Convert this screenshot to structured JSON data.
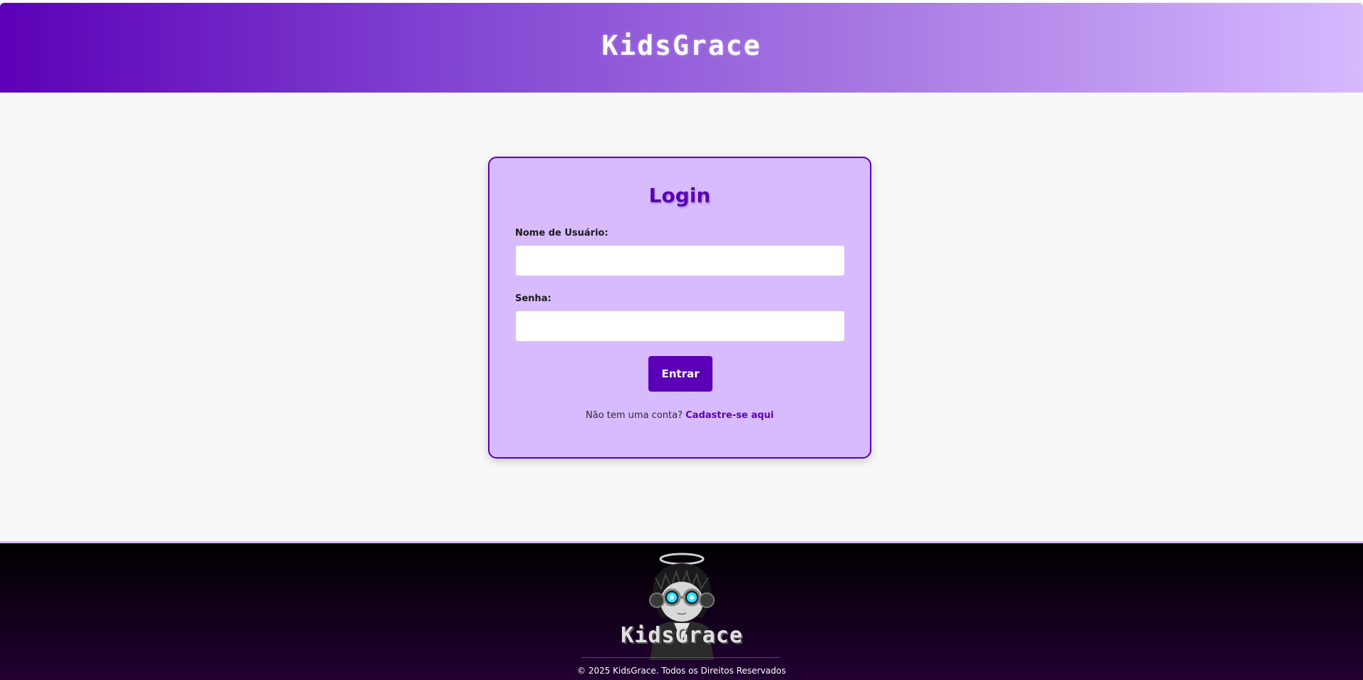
{
  "header": {
    "title": "KidsGrace"
  },
  "login": {
    "title": "Login",
    "username_label": "Nome de Usuário:",
    "username_value": "",
    "password_label": "Senha:",
    "password_value": "",
    "submit_label": "Entrar",
    "signup_prompt": "Não tem uma conta?",
    "signup_link": "Cadastre-se aqui"
  },
  "footer": {
    "logo_text": "KidsGrace",
    "copyright": "© 2025 KidsGrace. Todos os Direitos Reservados"
  },
  "colors": {
    "primary": "#5c00b7",
    "card_bg": "#d8bbff",
    "page_bg": "#f8f8f8",
    "footer_bg": "#000000"
  },
  "icons": {
    "footer_logo": "kid-with-halo-and-goggles-logo"
  }
}
